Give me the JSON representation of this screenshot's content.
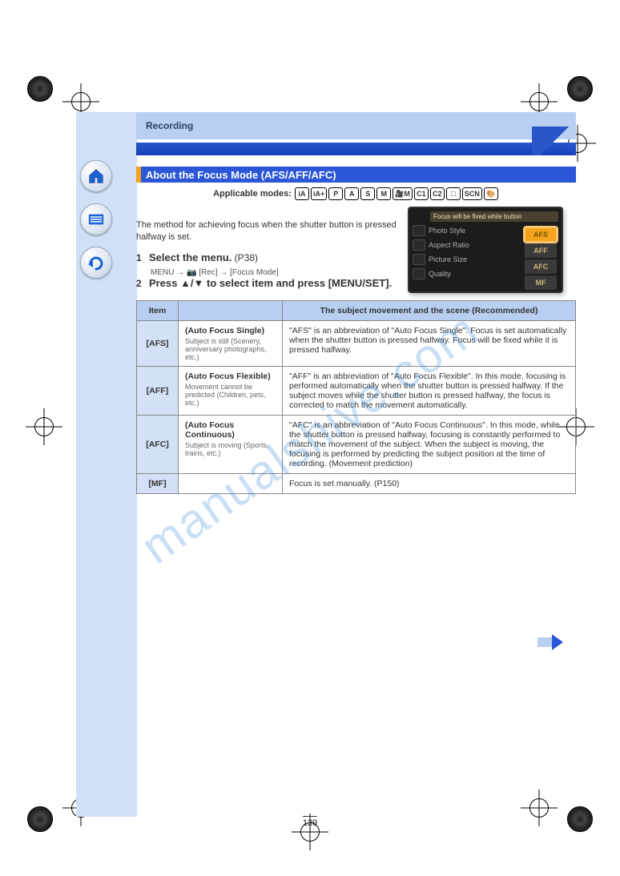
{
  "watermark": "manualshive.com",
  "header_category": "Recording",
  "section_title": "About the Focus Mode (AFS/AFF/AFC)",
  "applicable_modes_label": "Applicable modes:",
  "mode_icons": [
    "iA",
    "iA+",
    "P",
    "A",
    "S",
    "M",
    "🎥M",
    "C1",
    "C2",
    "□",
    "SCN",
    "🎨"
  ],
  "intro_text": "The method for achieving focus when the shutter button is pressed halfway is set.",
  "steps": [
    {
      "num": "1",
      "bold": "Select the menu.",
      "rest": " (P38)",
      "menu_path": "MENU → 📷 [Rec] → [Focus Mode]"
    },
    {
      "num": "2",
      "bold": "Press ▲/▼ to select item and press [MENU/SET].",
      "rest": ""
    }
  ],
  "thumbnail": {
    "banner": "Focus will be fixed while button",
    "rows": [
      {
        "icon": "photo-style",
        "label": "Photo Style"
      },
      {
        "icon": "aspect-ratio",
        "label": "Aspect Ratio"
      },
      {
        "icon": "picture-size",
        "label": "Picture Size"
      },
      {
        "icon": "quality",
        "label": "Quality"
      }
    ],
    "options": [
      "AFS",
      "AFF",
      "AFC",
      "MF"
    ],
    "selected": "AFS"
  },
  "table": {
    "headers": [
      "Item",
      "",
      "The subject movement and the scene (Recommended)"
    ],
    "rows": [
      {
        "mode": "[AFS]",
        "sub_title": "(Auto Focus Single)",
        "sub_desc": "Subject is still (Scenery, anniversary photographs, etc.)",
        "desc": "\"AFS\" is an abbreviation of \"Auto Focus Single\". Focus is set automatically when the shutter button is pressed halfway. Focus will be fixed while it is pressed halfway."
      },
      {
        "mode": "[AFF]",
        "sub_title": "(Auto Focus Flexible)",
        "sub_desc": "Movement cannot be predicted (Children, pets, etc.)",
        "desc": "\"AFF\" is an abbreviation of \"Auto Focus Flexible\". In this mode, focusing is performed automatically when the shutter button is pressed halfway.\nIf the subject moves while the shutter button is pressed halfway, the focus is corrected to match the movement automatically."
      },
      {
        "mode": "[AFC]",
        "sub_title": "(Auto Focus Continuous)",
        "sub_desc": "Subject is moving (Sports, trains, etc.)",
        "desc": "\"AFC\" is an abbreviation of \"Auto Focus Continuous\". In this mode, while the shutter button is pressed halfway, focusing is constantly performed to match the movement of the subject.\nWhen the subject is moving, the focusing is performed by predicting the subject position at the time of recording. (Movement prediction)"
      },
      {
        "mode": "[MF]",
        "sub_title": "",
        "sub_desc": "",
        "desc": "Focus is set manually. (P150)"
      }
    ]
  },
  "page_number": "139",
  "nav_buttons": [
    {
      "name": "home",
      "glyph": "⌂"
    },
    {
      "name": "menu",
      "glyph": "☰"
    },
    {
      "name": "back",
      "glyph": "↶"
    }
  ]
}
